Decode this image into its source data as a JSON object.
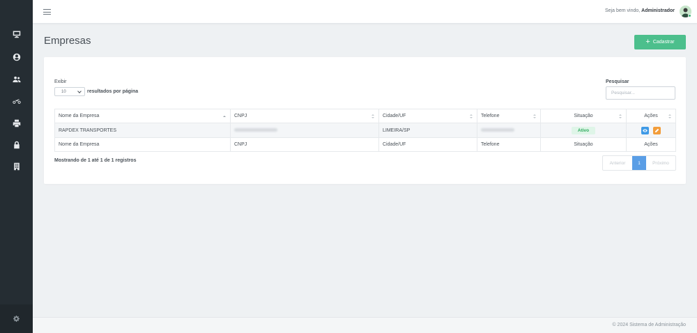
{
  "app": {
    "welcome_prefix": "Seja bem vindo,",
    "user_name": "Administrador"
  },
  "sidebar": {
    "items": [
      {
        "name": "dashboard",
        "icon": "monitor-icon"
      },
      {
        "name": "perfil",
        "icon": "user-circle-icon"
      },
      {
        "name": "usuarios",
        "icon": "users-icon"
      },
      {
        "name": "motos",
        "icon": "motorcycle-icon"
      },
      {
        "name": "impressao",
        "icon": "printer-icon"
      },
      {
        "name": "seguranca",
        "icon": "lock-icon"
      },
      {
        "name": "empresas",
        "icon": "building-icon"
      }
    ],
    "settings_icon": "gear-icon"
  },
  "page": {
    "title": "Empresas",
    "add_button": "Cadastrar"
  },
  "filters": {
    "show_label": "Exibir",
    "page_length": "10",
    "results_label": "resultados por página",
    "search_label": "Pesquisar",
    "search_placeholder": "Pesquisar..."
  },
  "table": {
    "headers": [
      "Nome da Empresa",
      "CNPJ",
      "Cidade/UF",
      "Telefone",
      "Situação",
      "Ações"
    ],
    "rows": [
      {
        "nome": "RAPDEX TRANSPORTES",
        "cnpj": "",
        "cidade": "LIMEIRA/SP",
        "telefone": "",
        "situacao": "Ativo"
      }
    ],
    "footer": [
      "Nome da Empresa",
      "CNPJ",
      "Cidade/UF",
      "Telefone",
      "Situação",
      "Ações"
    ]
  },
  "pagination": {
    "info": "Mostrando de 1 até 1 de 1 registros",
    "prev": "Anterior",
    "current": "1",
    "next": "Próximo"
  },
  "footer": {
    "text": "© 2024 Sistema de Administração"
  },
  "colors": {
    "sidebar": "#252d33",
    "primary_button": "#4cbf8c",
    "status_active": "#2eaa5d",
    "view_button": "#3f9ae6",
    "edit_button": "#f29d3b",
    "pager_active": "#5a9ee6"
  }
}
